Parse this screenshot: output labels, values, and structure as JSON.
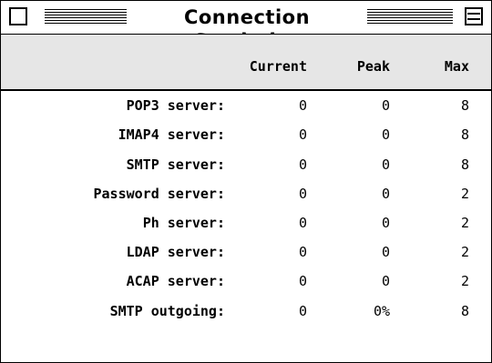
{
  "window": {
    "title": "Connection Statistics"
  },
  "columns": {
    "current": "Current",
    "peak": "Peak",
    "max": "Max"
  },
  "rows": [
    {
      "label": "POP3 server:",
      "current": "0",
      "peak": "0",
      "max": "8"
    },
    {
      "label": "IMAP4 server:",
      "current": "0",
      "peak": "0",
      "max": "8"
    },
    {
      "label": "SMTP server:",
      "current": "0",
      "peak": "0",
      "max": "8"
    },
    {
      "label": "Password server:",
      "current": "0",
      "peak": "0",
      "max": "2"
    },
    {
      "label": "Ph server:",
      "current": "0",
      "peak": "0",
      "max": "2"
    },
    {
      "label": "LDAP server:",
      "current": "0",
      "peak": "0",
      "max": "2"
    },
    {
      "label": "ACAP server:",
      "current": "0",
      "peak": "0",
      "max": "2"
    },
    {
      "label": "SMTP outgoing:",
      "current": "0",
      "peak": "0%",
      "max": "8"
    }
  ],
  "icons": {
    "close": "close-box-icon",
    "zoom": "zoom-box-icon"
  }
}
